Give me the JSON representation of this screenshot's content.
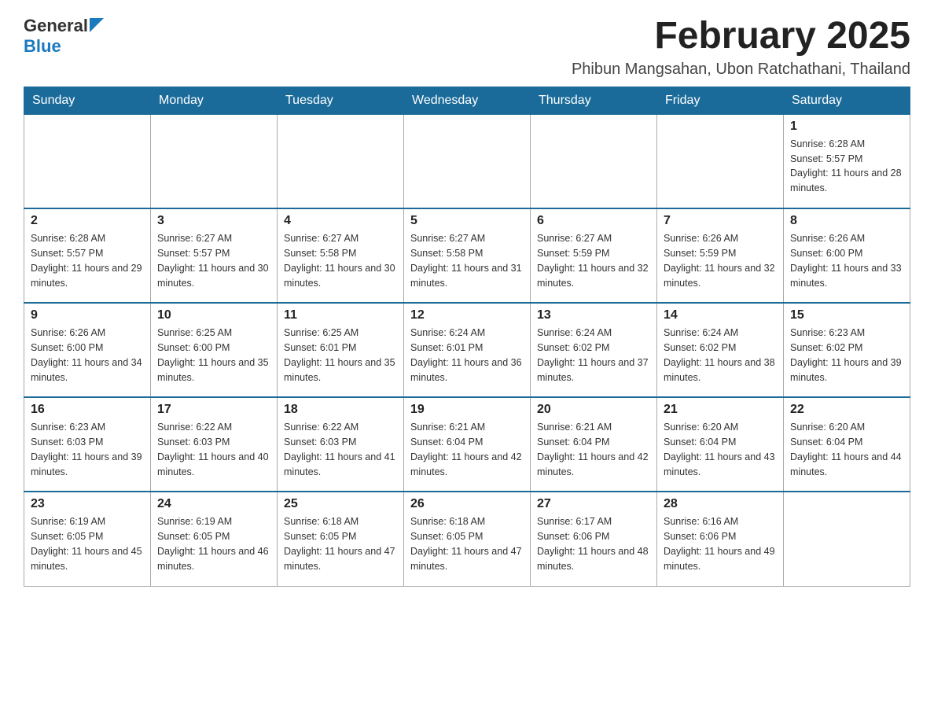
{
  "header": {
    "logo_general": "General",
    "logo_blue": "Blue",
    "month_title": "February 2025",
    "location": "Phibun Mangsahan, Ubon Ratchathani, Thailand"
  },
  "days_of_week": [
    "Sunday",
    "Monday",
    "Tuesday",
    "Wednesday",
    "Thursday",
    "Friday",
    "Saturday"
  ],
  "weeks": [
    [
      {
        "day": "",
        "sunrise": "",
        "sunset": "",
        "daylight": ""
      },
      {
        "day": "",
        "sunrise": "",
        "sunset": "",
        "daylight": ""
      },
      {
        "day": "",
        "sunrise": "",
        "sunset": "",
        "daylight": ""
      },
      {
        "day": "",
        "sunrise": "",
        "sunset": "",
        "daylight": ""
      },
      {
        "day": "",
        "sunrise": "",
        "sunset": "",
        "daylight": ""
      },
      {
        "day": "",
        "sunrise": "",
        "sunset": "",
        "daylight": ""
      },
      {
        "day": "1",
        "sunrise": "Sunrise: 6:28 AM",
        "sunset": "Sunset: 5:57 PM",
        "daylight": "Daylight: 11 hours and 28 minutes."
      }
    ],
    [
      {
        "day": "2",
        "sunrise": "Sunrise: 6:28 AM",
        "sunset": "Sunset: 5:57 PM",
        "daylight": "Daylight: 11 hours and 29 minutes."
      },
      {
        "day": "3",
        "sunrise": "Sunrise: 6:27 AM",
        "sunset": "Sunset: 5:57 PM",
        "daylight": "Daylight: 11 hours and 30 minutes."
      },
      {
        "day": "4",
        "sunrise": "Sunrise: 6:27 AM",
        "sunset": "Sunset: 5:58 PM",
        "daylight": "Daylight: 11 hours and 30 minutes."
      },
      {
        "day": "5",
        "sunrise": "Sunrise: 6:27 AM",
        "sunset": "Sunset: 5:58 PM",
        "daylight": "Daylight: 11 hours and 31 minutes."
      },
      {
        "day": "6",
        "sunrise": "Sunrise: 6:27 AM",
        "sunset": "Sunset: 5:59 PM",
        "daylight": "Daylight: 11 hours and 32 minutes."
      },
      {
        "day": "7",
        "sunrise": "Sunrise: 6:26 AM",
        "sunset": "Sunset: 5:59 PM",
        "daylight": "Daylight: 11 hours and 32 minutes."
      },
      {
        "day": "8",
        "sunrise": "Sunrise: 6:26 AM",
        "sunset": "Sunset: 6:00 PM",
        "daylight": "Daylight: 11 hours and 33 minutes."
      }
    ],
    [
      {
        "day": "9",
        "sunrise": "Sunrise: 6:26 AM",
        "sunset": "Sunset: 6:00 PM",
        "daylight": "Daylight: 11 hours and 34 minutes."
      },
      {
        "day": "10",
        "sunrise": "Sunrise: 6:25 AM",
        "sunset": "Sunset: 6:00 PM",
        "daylight": "Daylight: 11 hours and 35 minutes."
      },
      {
        "day": "11",
        "sunrise": "Sunrise: 6:25 AM",
        "sunset": "Sunset: 6:01 PM",
        "daylight": "Daylight: 11 hours and 35 minutes."
      },
      {
        "day": "12",
        "sunrise": "Sunrise: 6:24 AM",
        "sunset": "Sunset: 6:01 PM",
        "daylight": "Daylight: 11 hours and 36 minutes."
      },
      {
        "day": "13",
        "sunrise": "Sunrise: 6:24 AM",
        "sunset": "Sunset: 6:02 PM",
        "daylight": "Daylight: 11 hours and 37 minutes."
      },
      {
        "day": "14",
        "sunrise": "Sunrise: 6:24 AM",
        "sunset": "Sunset: 6:02 PM",
        "daylight": "Daylight: 11 hours and 38 minutes."
      },
      {
        "day": "15",
        "sunrise": "Sunrise: 6:23 AM",
        "sunset": "Sunset: 6:02 PM",
        "daylight": "Daylight: 11 hours and 39 minutes."
      }
    ],
    [
      {
        "day": "16",
        "sunrise": "Sunrise: 6:23 AM",
        "sunset": "Sunset: 6:03 PM",
        "daylight": "Daylight: 11 hours and 39 minutes."
      },
      {
        "day": "17",
        "sunrise": "Sunrise: 6:22 AM",
        "sunset": "Sunset: 6:03 PM",
        "daylight": "Daylight: 11 hours and 40 minutes."
      },
      {
        "day": "18",
        "sunrise": "Sunrise: 6:22 AM",
        "sunset": "Sunset: 6:03 PM",
        "daylight": "Daylight: 11 hours and 41 minutes."
      },
      {
        "day": "19",
        "sunrise": "Sunrise: 6:21 AM",
        "sunset": "Sunset: 6:04 PM",
        "daylight": "Daylight: 11 hours and 42 minutes."
      },
      {
        "day": "20",
        "sunrise": "Sunrise: 6:21 AM",
        "sunset": "Sunset: 6:04 PM",
        "daylight": "Daylight: 11 hours and 42 minutes."
      },
      {
        "day": "21",
        "sunrise": "Sunrise: 6:20 AM",
        "sunset": "Sunset: 6:04 PM",
        "daylight": "Daylight: 11 hours and 43 minutes."
      },
      {
        "day": "22",
        "sunrise": "Sunrise: 6:20 AM",
        "sunset": "Sunset: 6:04 PM",
        "daylight": "Daylight: 11 hours and 44 minutes."
      }
    ],
    [
      {
        "day": "23",
        "sunrise": "Sunrise: 6:19 AM",
        "sunset": "Sunset: 6:05 PM",
        "daylight": "Daylight: 11 hours and 45 minutes."
      },
      {
        "day": "24",
        "sunrise": "Sunrise: 6:19 AM",
        "sunset": "Sunset: 6:05 PM",
        "daylight": "Daylight: 11 hours and 46 minutes."
      },
      {
        "day": "25",
        "sunrise": "Sunrise: 6:18 AM",
        "sunset": "Sunset: 6:05 PM",
        "daylight": "Daylight: 11 hours and 47 minutes."
      },
      {
        "day": "26",
        "sunrise": "Sunrise: 6:18 AM",
        "sunset": "Sunset: 6:05 PM",
        "daylight": "Daylight: 11 hours and 47 minutes."
      },
      {
        "day": "27",
        "sunrise": "Sunrise: 6:17 AM",
        "sunset": "Sunset: 6:06 PM",
        "daylight": "Daylight: 11 hours and 48 minutes."
      },
      {
        "day": "28",
        "sunrise": "Sunrise: 6:16 AM",
        "sunset": "Sunset: 6:06 PM",
        "daylight": "Daylight: 11 hours and 49 minutes."
      },
      {
        "day": "",
        "sunrise": "",
        "sunset": "",
        "daylight": ""
      }
    ]
  ]
}
